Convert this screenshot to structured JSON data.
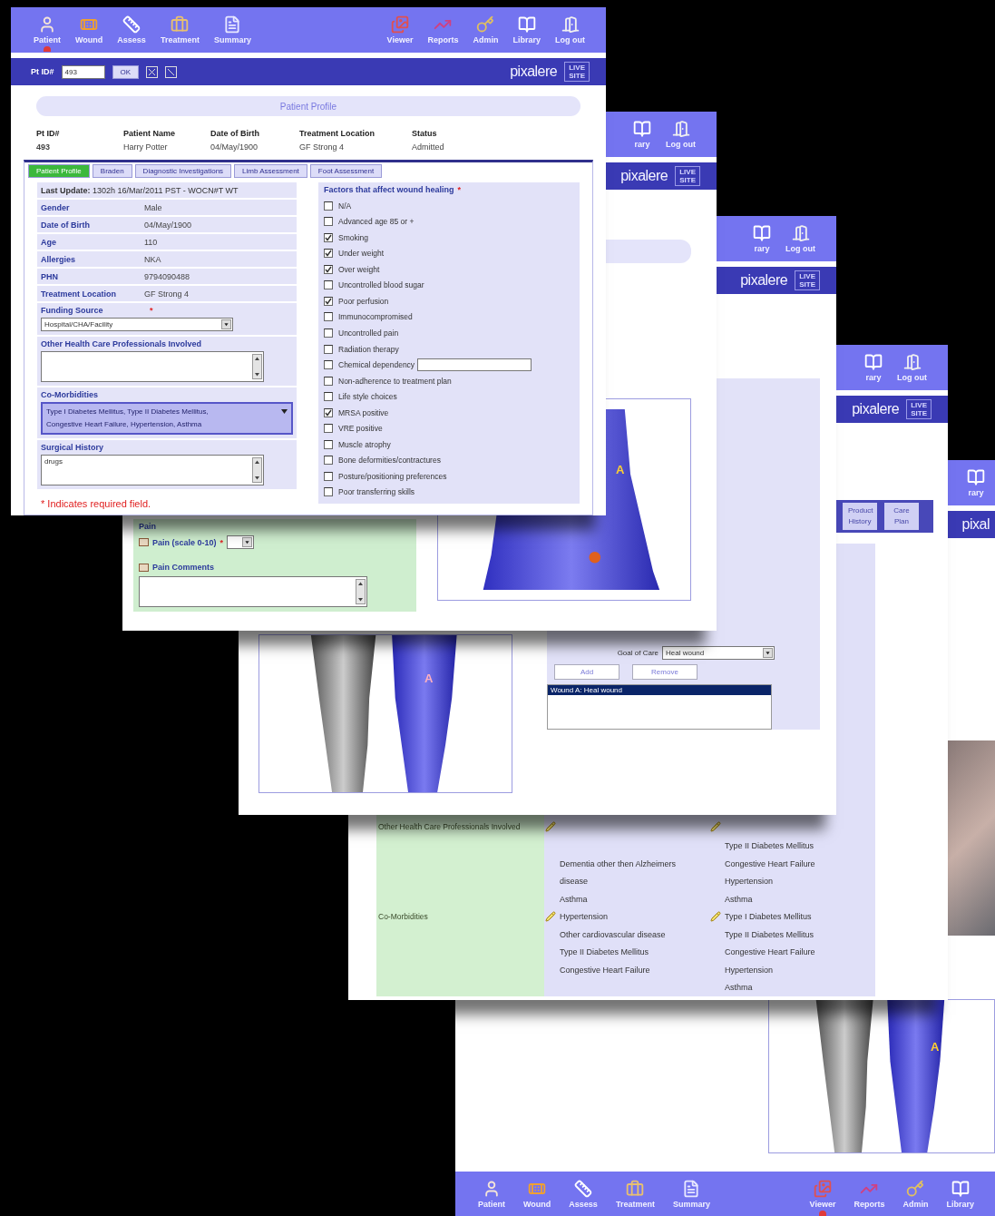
{
  "front_window": {
    "nav_left": [
      {
        "label": "Patient",
        "selected": true
      },
      {
        "label": "Wound",
        "selected": false
      },
      {
        "label": "Assess",
        "selected": false
      },
      {
        "label": "Treatment",
        "selected": false
      },
      {
        "label": "Summary",
        "selected": false
      }
    ],
    "nav_right": [
      {
        "label": "Viewer",
        "selected": false
      },
      {
        "label": "Reports",
        "selected": false
      },
      {
        "label": "Admin",
        "selected": false
      },
      {
        "label": "Library",
        "selected": false
      },
      {
        "label": "Log out",
        "selected": false
      }
    ],
    "id_bar": {
      "label": "Pt ID#",
      "value": "493",
      "button": "OK"
    },
    "brand": "pixalere",
    "badge": [
      "LIVE",
      "SITE"
    ],
    "profile_title": "Patient Profile",
    "summary": {
      "columns": [
        "Pt ID#",
        "Patient Name",
        "Date of Birth",
        "Treatment Location",
        "Status"
      ],
      "values": [
        "493",
        "Harry Potter",
        "04/May/1900",
        "GF Strong 4",
        "Admitted"
      ]
    },
    "tabs": [
      {
        "label": "Patient Profile",
        "selected": true
      },
      {
        "label": "Braden",
        "selected": false
      },
      {
        "label": "Diagnostic Investigations",
        "selected": false
      },
      {
        "label": "Limb Assessment",
        "selected": false
      },
      {
        "label": "Foot Assessment",
        "selected": false
      }
    ],
    "last_update": "**Last Update:** 1302h 16/Mar/2011 PST - WOCN#T WT",
    "details": [
      {
        "label": "Gender",
        "value": "Male"
      },
      {
        "label": "Date of Birth",
        "value": "04/May/1900"
      },
      {
        "label": "Age",
        "value": "110"
      },
      {
        "label": "Allergies",
        "value": "NKA"
      },
      {
        "label": "PHN",
        "value": "9794090488"
      },
      {
        "label": "Treatment Location",
        "value": "GF Strong 4"
      }
    ],
    "funding": {
      "label": "Funding Source",
      "required": "*",
      "value": "Hospital/CHA/Facility"
    },
    "other_professionals": {
      "label": "Other Health Care Professionals Involved"
    },
    "co_morbidities": {
      "label": "Co-Morbidities",
      "lines": [
        "Type I Diabetes Mellitus, Type II Diabetes Mellitus,",
        "Congestive Heart Failure, Hypertension, Asthma"
      ]
    },
    "surgical_history": {
      "label": "Surgical History",
      "value": "drugs"
    },
    "required_note": "* Indicates required field.",
    "factors": {
      "title": "Factors that affect wound healing",
      "required": "*",
      "items": [
        {
          "label": "N/A",
          "checked": false,
          "kind": "checkbox"
        },
        {
          "label": "Advanced age 85 or +",
          "checked": false,
          "kind": "checkbox"
        },
        {
          "label": "Smoking",
          "checked": true,
          "kind": "checkbox"
        },
        {
          "label": "Under weight",
          "checked": true,
          "kind": "checkbox"
        },
        {
          "label": "Over weight",
          "checked": true,
          "kind": "checkbox"
        },
        {
          "label": "Uncontrolled blood sugar",
          "checked": false,
          "kind": "checkbox"
        },
        {
          "label": "Poor perfusion",
          "checked": true,
          "kind": "checkbox"
        },
        {
          "label": "Immunocompromised",
          "checked": false,
          "kind": "checkbox"
        },
        {
          "label": "Uncontrolled pain",
          "checked": false,
          "kind": "checkbox"
        },
        {
          "label": "Radiation therapy",
          "checked": false,
          "kind": "checkbox"
        },
        {
          "label": "Chemical dependency",
          "checked": false,
          "kind": "checkbox_field"
        },
        {
          "label": "Non-adherence to treatment plan",
          "checked": false,
          "kind": "checkbox"
        },
        {
          "label": "Life style choices",
          "checked": false,
          "kind": "checkbox"
        },
        {
          "label": "MRSA positive",
          "checked": true,
          "kind": "checkbox"
        },
        {
          "label": "VRE positive",
          "checked": false,
          "kind": "checkbox"
        },
        {
          "label": "Muscle atrophy",
          "checked": false,
          "kind": "checkbox"
        },
        {
          "label": "Bone deformities/contractures",
          "checked": false,
          "kind": "checkbox"
        },
        {
          "label": "Posture/positioning preferences",
          "checked": false,
          "kind": "checkbox"
        },
        {
          "label": "Poor transferring skills",
          "checked": false,
          "kind": "checkbox"
        }
      ]
    }
  },
  "window_2": {
    "nav_right": [
      {
        "label": "rary",
        "selected": false
      },
      {
        "label": "Log out",
        "selected": false
      }
    ],
    "brand": "pixalere",
    "badge": [
      "LIVE",
      "SITE"
    ],
    "wound_marker": "A",
    "pain": {
      "title": "Pain",
      "scale_label": "Pain (scale 0-10)",
      "required": "*",
      "comments_label": "Pain Comments"
    }
  },
  "window_3": {
    "nav_right": [
      {
        "label": "rary",
        "selected": false
      },
      {
        "label": "Log out",
        "selected": false
      }
    ],
    "brand": "pixalere",
    "badge": [
      "LIVE",
      "SITE"
    ],
    "wound_marker": "A",
    "goal_label": "Goal of Care",
    "goal_value": "Heal wound",
    "buttons": [
      "Add",
      "Remove"
    ],
    "wounds": [
      {
        "label": "Wound A: Heal wound",
        "selected": true
      }
    ]
  },
  "window_4": {
    "nav_right": [
      {
        "label": "rary",
        "selected": false
      },
      {
        "label": "Log out",
        "selected": false
      }
    ],
    "brand": "pixalere",
    "badge": [
      "LIVE",
      "SITE"
    ],
    "tabs": [
      "Product History",
      "Care Plan"
    ],
    "rows": [
      {
        "label": "Other Health Care Professionals Involved"
      },
      {
        "label": "Co-Morbidities",
        "column_1": [
          {
            "text": "Dementia other then Alzheimers",
            "edit": false
          },
          {
            "text": "disease",
            "edit": false
          },
          {
            "text": "Asthma",
            "edit": false
          },
          {
            "text": "Hypertension",
            "edit": true
          },
          {
            "text": "Other cardiovascular disease",
            "edit": false
          },
          {
            "text": "Type II Diabetes Mellitus",
            "edit": false
          },
          {
            "text": "Congestive Heart Failure",
            "edit": false
          }
        ],
        "column_2": [
          {
            "text": "Type II Diabetes Mellitus",
            "edit": false
          },
          {
            "text": "Congestive Heart Failure",
            "edit": false
          },
          {
            "text": "Hypertension",
            "edit": false
          },
          {
            "text": "Asthma",
            "edit": false
          },
          {
            "text": "Type I Diabetes Mellitus",
            "edit": true
          },
          {
            "text": "Type II Diabetes Mellitus",
            "edit": false
          },
          {
            "text": "Congestive Heart Failure",
            "edit": false
          },
          {
            "text": "Hypertension",
            "edit": false
          },
          {
            "text": "Asthma",
            "edit": false
          }
        ]
      }
    ]
  },
  "window_5": {
    "nav_top": [
      {
        "label": "rary",
        "selected": false
      }
    ],
    "brand": "pixal",
    "wound_marker": "A",
    "nav_left": [
      {
        "label": "Patient",
        "selected": false
      },
      {
        "label": "Wound",
        "selected": false
      },
      {
        "label": "Assess",
        "selected": false
      },
      {
        "label": "Treatment",
        "selected": false
      },
      {
        "label": "Summary",
        "selected": false
      }
    ],
    "nav_right": [
      {
        "label": "Viewer",
        "selected": true
      },
      {
        "label": "Reports",
        "selected": false
      },
      {
        "label": "Admin",
        "selected": false
      },
      {
        "label": "Library",
        "selected": false
      }
    ]
  }
}
